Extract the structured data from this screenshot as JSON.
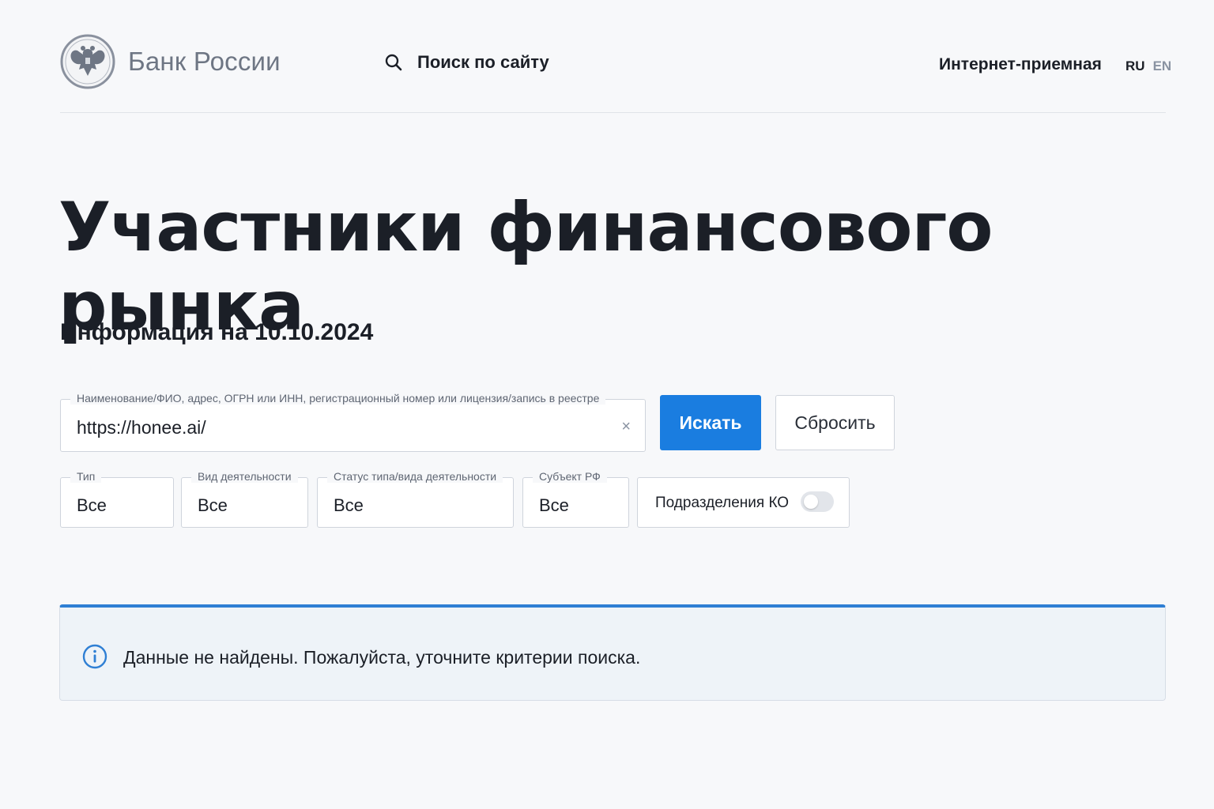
{
  "header": {
    "logo_text": "Банк России",
    "search_label": "Поиск по сайту",
    "reception_link": "Интернет-приемная",
    "languages": [
      "RU",
      "EN"
    ]
  },
  "page": {
    "title": "Участники финансового рынка",
    "info_date": "Информация на 10.10.2024"
  },
  "search": {
    "field_label": "Наименование/ФИО, адрес, ОГРН или ИНН, регистрационный номер или лицензия/запись в реестре",
    "value": "https://honee.ai/",
    "clear_symbol": "×",
    "submit_label": "Искать",
    "reset_label": "Сбросить"
  },
  "filters": [
    {
      "label": "Тип",
      "value": "Все"
    },
    {
      "label": "Вид деятельности",
      "value": "Все"
    },
    {
      "label": "Статус типа/вида деятельности",
      "value": "Все"
    },
    {
      "label": "Субъект РФ",
      "value": "Все"
    }
  ],
  "toggle": {
    "label": "Подразделения КО",
    "enabled": false
  },
  "notice": {
    "text": "Данные не найдены. Пожалуйста, уточните критерии поиска."
  },
  "colors": {
    "accent": "#1a7de0",
    "notice_border": "#2f7fd4",
    "notice_bg": "#eef3f8"
  },
  "icons": {
    "logo": "double-headed-eagle-emblem",
    "search": "magnifier-icon",
    "info": "info-circle-icon",
    "clear": "close-icon"
  }
}
